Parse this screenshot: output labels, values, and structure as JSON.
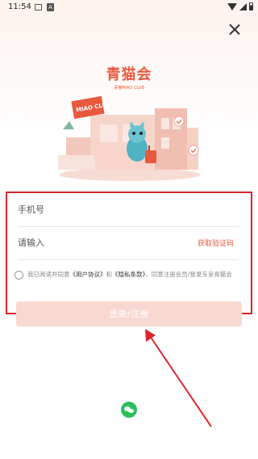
{
  "status_bar": {
    "time": "11:54",
    "notification_icons": [
      "image-icon",
      "a-icon"
    ],
    "right_icons": [
      "wifi-icon",
      "signal-icon",
      "battery-icon"
    ]
  },
  "brand": {
    "title": "青猫会",
    "subtitle": "青猫MIAO CLUB",
    "illustration_sign": "MIAO CLUB"
  },
  "form": {
    "phone_placeholder": "手机号",
    "code_placeholder": "请输入",
    "get_code_label": "获取验证码"
  },
  "agreement": {
    "prefix": "我已阅读并同意",
    "user_agreement": "《用户协议》",
    "and": "和",
    "privacy_policy": "《隐私条款》",
    "suffix": "，同意注册会员/登录东呈青猫会"
  },
  "login_button": "登录/注册",
  "colors": {
    "accent": "#e8593f",
    "button_bg": "#f9d8d2",
    "annotation_red": "#d9252e",
    "wechat_green": "#2cbf5f"
  }
}
